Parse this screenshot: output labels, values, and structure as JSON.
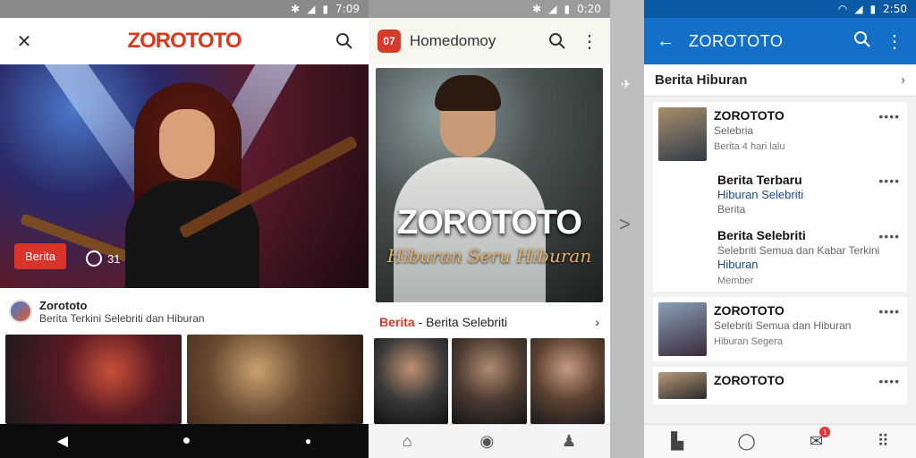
{
  "status": {
    "left_time": "7:09",
    "mid_time": "0:20",
    "right_time": "2:50"
  },
  "panel1": {
    "logo": "ZOROTOTO",
    "badge": "Berita",
    "counter": "31",
    "source_title": "Zorototo",
    "source_sub": "Berita Terkini Selebriti dan Hiburan"
  },
  "panel2": {
    "app_icon": "07",
    "title": "Homedomoy",
    "poster_title": "ZOROTOTO",
    "poster_sub": "Hiburan Seru Hiburan",
    "section_red": "Berita",
    "section_rest": " - Berita Selebriti"
  },
  "panel3": {
    "title": "ZOROTOTO",
    "section_header": "Berita Hiburan",
    "cards": [
      {
        "title": "ZOROTOTO",
        "sub": "Selebria",
        "meta": "Berita 4 hari lalu"
      },
      {
        "title": "Berita Terbaru",
        "blue": "Hiburan Selebriti",
        "sub": "Berita"
      },
      {
        "title": "Berita Selebriti",
        "sub": "Selebriti Semua dan Kabar Terkini",
        "blue": "Hiburan",
        "meta": "Member"
      },
      {
        "title": "ZOROTOTO",
        "sub": "Selebriti Semua dan Hiburan",
        "meta": "Hiburan Segera"
      },
      {
        "title": "ZOROTOTO"
      }
    ],
    "notif_count": "1"
  },
  "colors": {
    "brand_red": "#d73a1f",
    "toolbar_blue": "#1470c7",
    "link_blue": "#1a4a8a"
  }
}
